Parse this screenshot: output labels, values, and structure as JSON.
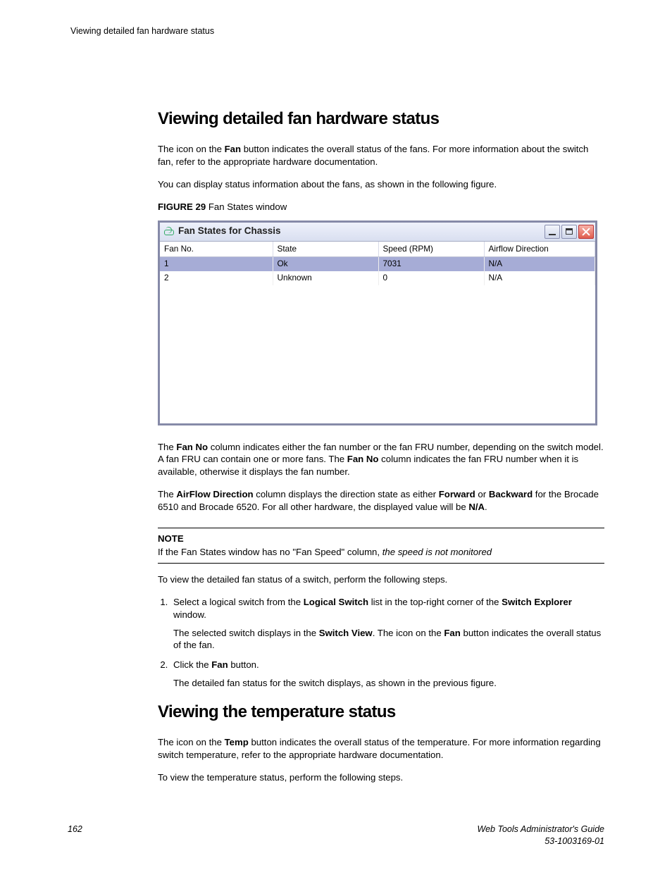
{
  "header": {
    "running_title": "Viewing detailed fan hardware status"
  },
  "section1": {
    "heading": "Viewing detailed fan hardware status",
    "p1a": "The icon on the ",
    "p1b": "Fan",
    "p1c": " button indicates the overall status of the fans. For more information about the switch fan, refer to the appropriate hardware documentation.",
    "p2": "You can display status information about the fans, as shown in the following figure.",
    "fig_label": "FIGURE 29",
    "fig_text": " Fan States window"
  },
  "window": {
    "title": "Fan States for Chassis",
    "columns": [
      "Fan No.",
      "State",
      "Speed (RPM)",
      "Airflow Direction"
    ],
    "rows": [
      {
        "fan_no": "1",
        "state": "Ok",
        "speed": "7031",
        "airflow": "N/A",
        "selected": true
      },
      {
        "fan_no": "2",
        "state": "Unknown",
        "speed": "0",
        "airflow": "N/A",
        "selected": false
      }
    ]
  },
  "after_fig": {
    "p3a": "The ",
    "p3b": "Fan No",
    "p3c": " column indicates either the fan number or the fan FRU number, depending on the switch model. A fan FRU can contain one or more fans. The ",
    "p3d": "Fan No",
    "p3e": " column indicates the fan FRU number when it is available, otherwise it displays the fan number.",
    "p4a": "The ",
    "p4b": "AirFlow Direction",
    "p4c": " column displays the direction state as either ",
    "p4d": "Forward",
    "p4e": " or ",
    "p4f": "Backward",
    "p4g": " for the Brocade 6510 and Brocade 6520. For all other hardware, the displayed value will be ",
    "p4h": "N/A",
    "p4i": "."
  },
  "note": {
    "label": "NOTE",
    "body_a": "If the Fan States window has no \"Fan Speed\" column, ",
    "body_b": "the speed is not monitored"
  },
  "steps_intro": "To view the detailed fan status of a switch, perform the following steps.",
  "step1": {
    "a": "Select a logical switch from the ",
    "b": "Logical Switch",
    "c": " list in the top-right corner of the ",
    "d": "Switch Explorer",
    "e": " window.",
    "body_a": "The selected switch displays in the ",
    "body_b": "Switch View",
    "body_c": ". The icon on the ",
    "body_d": "Fan",
    "body_e": " button indicates the overall status of the fan."
  },
  "step2": {
    "a": "Click the ",
    "b": "Fan",
    "c": " button.",
    "body": "The detailed fan status for the switch displays, as shown in the previous figure."
  },
  "section2": {
    "heading": "Viewing the temperature status",
    "p1a": "The icon on the ",
    "p1b": "Temp",
    "p1c": " button indicates the overall status of the temperature. For more information regarding switch temperature, refer to the appropriate hardware documentation.",
    "p2": "To view the temperature status, perform the following steps."
  },
  "footer": {
    "page_no": "162",
    "doc_title": "Web Tools Administrator's Guide",
    "doc_id": "53-1003169-01"
  }
}
